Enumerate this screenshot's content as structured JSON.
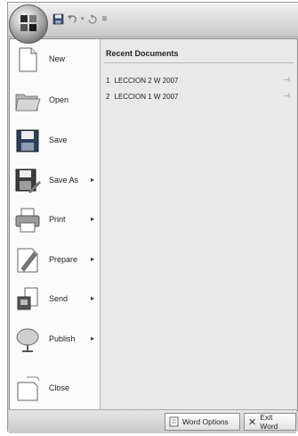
{
  "toolbar": {
    "customize_glyph": "≡"
  },
  "menu_items": [
    {
      "label": "New",
      "icon": "new-document-icon",
      "has_submenu": false
    },
    {
      "label": "Open",
      "icon": "open-folder-icon",
      "has_submenu": false
    },
    {
      "label": "Save",
      "icon": "save-disk-icon",
      "has_submenu": false
    },
    {
      "label": "Save As",
      "icon": "save-as-icon",
      "has_submenu": true
    },
    {
      "label": "Print",
      "icon": "printer-icon",
      "has_submenu": true
    },
    {
      "label": "Prepare",
      "icon": "prepare-icon",
      "has_submenu": true
    },
    {
      "label": "Send",
      "icon": "send-icon",
      "has_submenu": true
    },
    {
      "label": "Publish",
      "icon": "publish-icon",
      "has_submenu": true
    },
    {
      "label": "Close",
      "icon": "close-document-icon",
      "has_submenu": false
    }
  ],
  "recent": {
    "title": "Recent Documents",
    "documents": [
      {
        "index": "1",
        "name": "LECCION 2 W 2007"
      },
      {
        "index": "2",
        "name": "LECCION 1 W 2007"
      }
    ]
  },
  "footer": {
    "word_options_label": "Word Options",
    "exit_word_label": "Exit Word"
  },
  "colors": {
    "menu_left_bg": "#fafafa",
    "menu_right_bg": "#e9e9e9",
    "frame_bg": "#cfcfcf"
  }
}
